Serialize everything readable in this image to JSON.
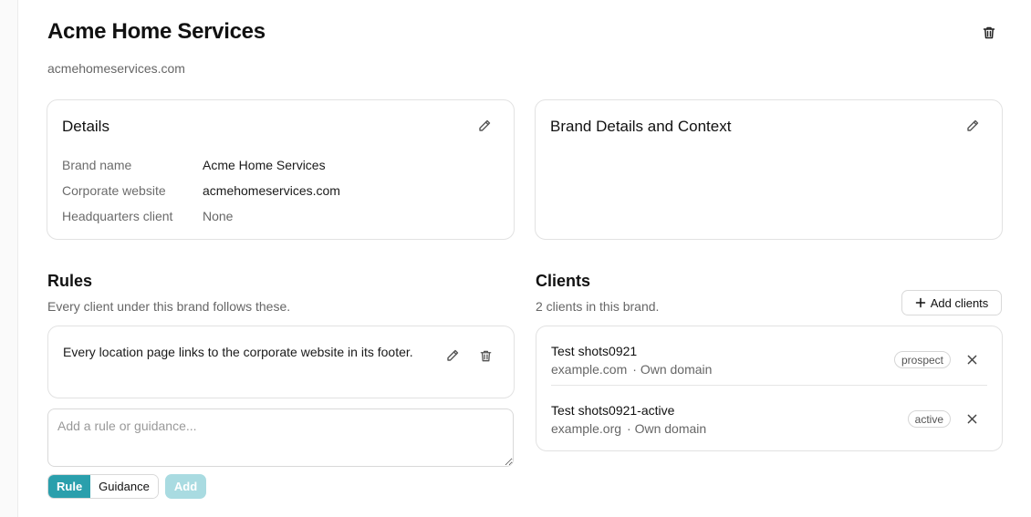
{
  "header": {
    "title": "Acme Home Services",
    "subtitle": "acmehomeservices.com",
    "delete_icon": "trash-icon"
  },
  "details": {
    "title": "Details",
    "edit_icon": "pencil-icon",
    "rows": [
      {
        "label": "Brand name",
        "value": "Acme Home Services"
      },
      {
        "label": "Corporate website",
        "value": "acmehomeservices.com"
      },
      {
        "label": "Headquarters client",
        "value": "None"
      }
    ]
  },
  "brand_context": {
    "title": "Brand Details and Context",
    "edit_icon": "pencil-icon"
  },
  "rules": {
    "title": "Rules",
    "subtitle": "Every client under this brand follows these.",
    "items": [
      {
        "text": "Every location page links to the corporate website in its footer."
      }
    ],
    "input_placeholder": "Add a rule or guidance...",
    "type_options": [
      "Rule",
      "Guidance"
    ],
    "selected_type": "Rule",
    "add_label": "Add"
  },
  "clients": {
    "title": "Clients",
    "subtitle": "2 clients in this brand.",
    "add_label": "Add clients",
    "items": [
      {
        "name": "Test shots0921",
        "domain": "example.com",
        "domain_type": "· Own domain",
        "status": "prospect"
      },
      {
        "name": "Test shots0921-active",
        "domain": "example.org",
        "domain_type": "· Own domain",
        "status": "active"
      }
    ]
  },
  "colors": {
    "accent": "#2a9fac",
    "accent_disabled": "#a9dbe1",
    "border": "#e2e2e2",
    "muted_text": "#666666"
  }
}
